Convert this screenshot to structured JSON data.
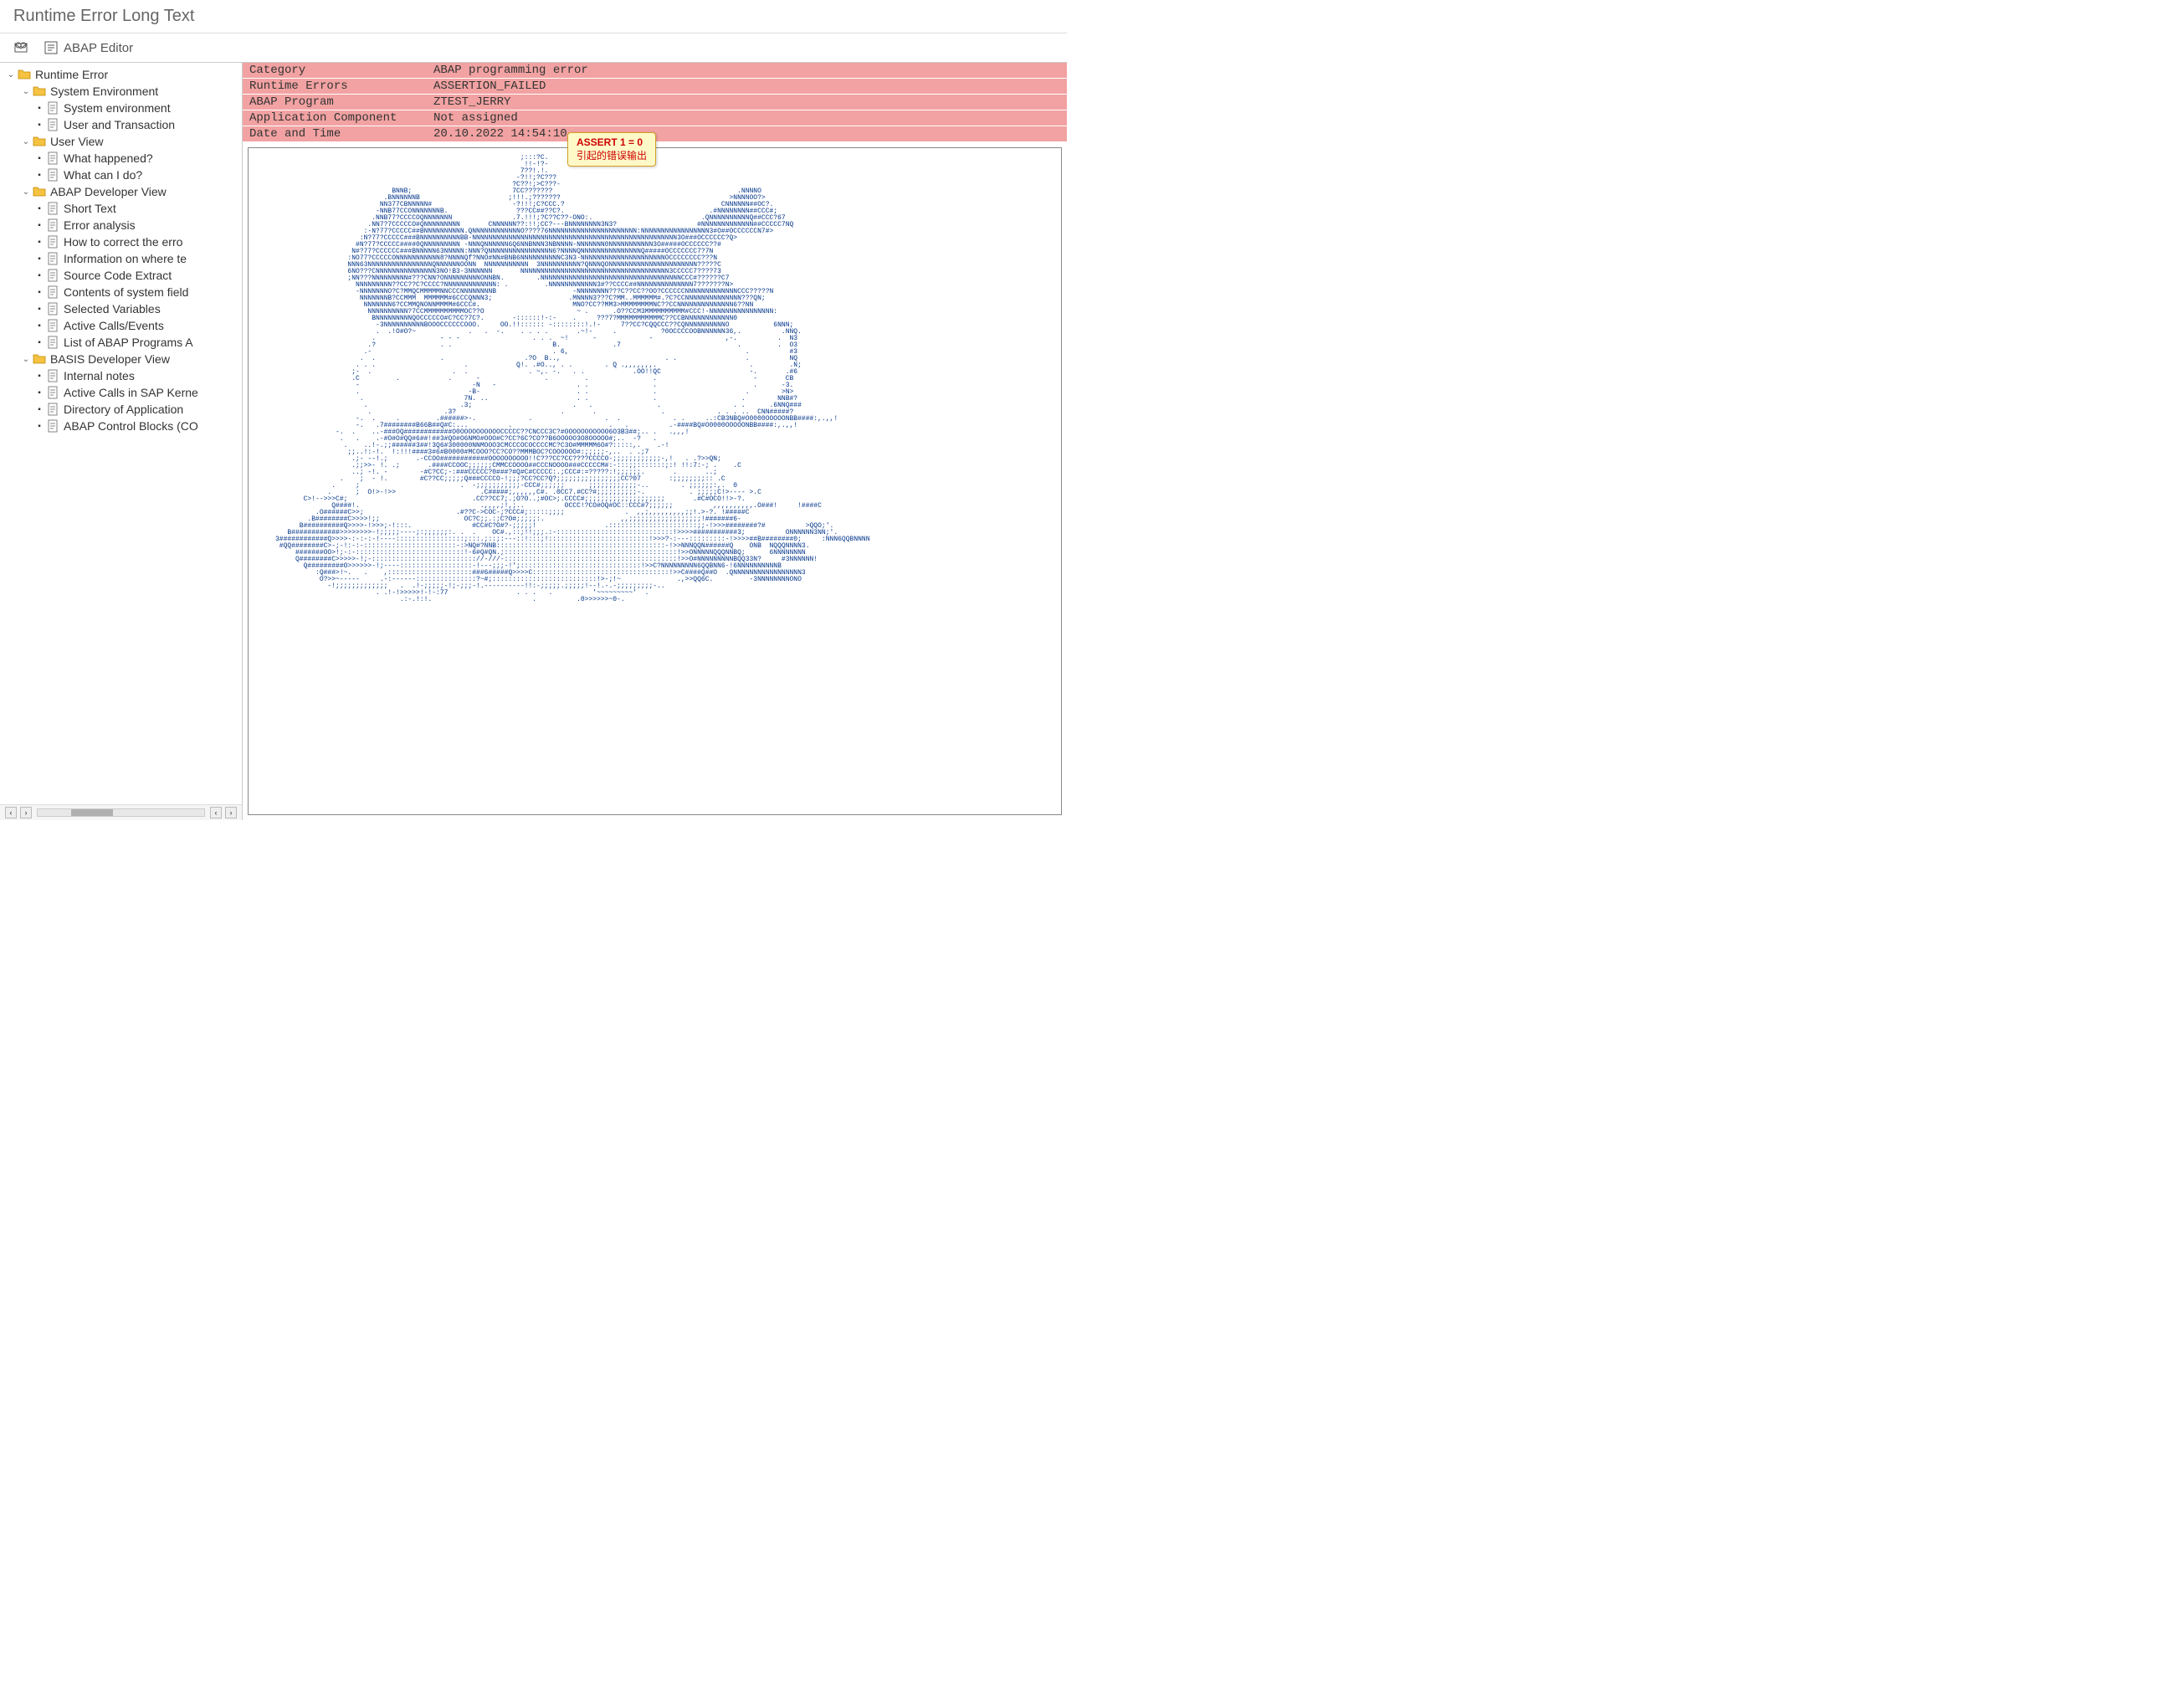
{
  "title": "Runtime Error Long Text",
  "toolbar": {
    "editor_label": "ABAP Editor"
  },
  "tree": [
    {
      "label": "Runtime Error",
      "type": "folder",
      "indent": 0,
      "expanded": true
    },
    {
      "label": "System Environment",
      "type": "folder",
      "indent": 1,
      "expanded": true
    },
    {
      "label": "System environment",
      "type": "doc",
      "indent": 2
    },
    {
      "label": "User and Transaction",
      "type": "doc",
      "indent": 2
    },
    {
      "label": "User View",
      "type": "folder",
      "indent": 1,
      "expanded": true
    },
    {
      "label": "What happened?",
      "type": "doc",
      "indent": 2
    },
    {
      "label": "What can I do?",
      "type": "doc",
      "indent": 2
    },
    {
      "label": "ABAP Developer View",
      "type": "folder",
      "indent": 1,
      "expanded": true
    },
    {
      "label": "Short Text",
      "type": "doc",
      "indent": 2
    },
    {
      "label": "Error analysis",
      "type": "doc",
      "indent": 2
    },
    {
      "label": "How to correct the erro",
      "type": "doc",
      "indent": 2
    },
    {
      "label": "Information on where te",
      "type": "doc",
      "indent": 2
    },
    {
      "label": "Source Code Extract",
      "type": "doc",
      "indent": 2
    },
    {
      "label": "Contents of system field",
      "type": "doc",
      "indent": 2
    },
    {
      "label": "Selected Variables",
      "type": "doc",
      "indent": 2
    },
    {
      "label": "Active Calls/Events",
      "type": "doc",
      "indent": 2
    },
    {
      "label": "List of ABAP Programs A",
      "type": "doc",
      "indent": 2
    },
    {
      "label": "BASIS Developer View",
      "type": "folder",
      "indent": 1,
      "expanded": true
    },
    {
      "label": "Internal notes",
      "type": "doc",
      "indent": 2
    },
    {
      "label": "Active Calls in SAP Kerne",
      "type": "doc",
      "indent": 2
    },
    {
      "label": "Directory of Application",
      "type": "doc",
      "indent": 2
    },
    {
      "label": "ABAP Control Blocks (CO",
      "type": "doc",
      "indent": 2
    }
  ],
  "header": {
    "rows": [
      {
        "key": "Category",
        "value": "ABAP programming error"
      },
      {
        "key": "Runtime Errors",
        "value": "ASSERTION_FAILED"
      },
      {
        "key": "ABAP Program",
        "value": "ZTEST_JERRY"
      },
      {
        "key": "Application Component",
        "value": "Not assigned"
      },
      {
        "key": "Date and Time",
        "value": "20.10.2022 14:54:10"
      }
    ]
  },
  "callout": {
    "line1": "ASSERT 1 = 0",
    "line2": "引起的错误输出"
  },
  "ascii": "                                                                  ;:::?C.\n                                                                   !!-!?-\n                                                                  7??!.!.\n                                                                 -?!!;?C???\n                                                                ?C??!;>C???-\n                                  BNNB;                         7CC???????                                              .NNNNO\n                                .BNNNNNNB                      ;!!!.;???????                                          >NNNNOO?>\n                               NN377CBNNNNN#                    -?!!!;C?CCC.?                                       CNNNNNN##OC?.\n                              -NNB77CCONNNNNNNB.                 ???CC##??C?.                                    .#NNNNNNNN##CCC#;\n                             .NNB77?CCCCOQNNNNNNN               .7.!!!;?C??C??-ONO:.                           .QNNNNNNNNNNQ##CCC?67\n                            .NN7?7CCCCCO#QNNNNNNNNN       CNNNNNN??:!!;CC?---BNNNNNNNN3N3?                    #NNNNNNNNNNNNN##CCCCC7NQ\n                           :-N?77?CCCCC##BNNNNNNNNNN.QNNNNNNNNNNNNO????76NNNNNNNNNNNNNNNNNNNNNN:NNNNNNNNNNNNNNNNN3#O##OCCCCCCN7#>\n                          :N?77?CCCCC###BNNNNNNNNNNBB-NNNNNNNNNNNNNNNNNNNNNNNNNNNNNNNNNNNNNNNNNNNNNNNNNNN3O###OCCCCCC?Q>\n                         #N?77?CCCCC####0QNNNNNNNNN -NNNQNNNNNN6Q6NNBNNN3NBNNNN-NNNNNNN0NNNNNNNNNNN3O#####OCCCCCC??#\n                        N#?77?CCCCCC###BNNNNN63NNNNN:NNN?QNNNNNNNNNNNNNNNN6?NNNNQNNNNNNNNNNNNNNNQ#####OCCCCCCC7?7N\n                       :NO77?CCCCCONNNNNNNNNNN8?NNNNQf?NNO#NN#BNB6NNNNNNNNNNC3N3-NNNNNNNNNNNNNNNNNNNNNOCCCCCCCC???N\n                       NNN63NNNNNNNNNNNNNNNNQNNNNNNOONN  NNNNNNNNNNN  3NNNNNNNNNN?QNNNQONNNNNNNNNNNNNNNNNNNNNN?????C\n                       6NO???CNNNNNNNNNNNNNNN3NO!B3-3NNNNNN       NNNNNNNNNNNNNNNNNNNNNNNNNNNNNNNNNNNNN3CCCCC7????73\n                       ;NN???NNNNNNNNN#???CNN?ONNNNNNNNNONNBN.        .NNNNNNNNNNNNNNNNNNNNNNNNNNNNNNNNNNNCCC#??????C7\n                         NNNNNNNNN??CC??C?CCCC?NNNNNNNNNNNNN: .         .NNNNNNNNNNNN3#??CCCC##NNNNNNNNNNNNNN7???????N>\n                         -NNNNNNNO?C?MMQCMMMMMNNCCCNNNNNNNNB                   -NNNNNNNN???C??CC??OO?CCCCCCNNNNNNNNNNNNNCCC?????N\n                          NNNNNNNB?CCMMM  MMMMMM#6CCCQNNN3;                   .MNNNN3???C?MM..MMMMMM#.?C?CCNNNNNNNNNNNNNN???QN;\n                           NNNNNNN6?CCMMQNONNMMMM#6CCC#.                       MNO?CC??MM3>MMMMMMMMNC??CCNNNNNNNNNNNNNN6??NN\n                            NNNNNNNNNN?7CCMMMMMMMMMMOC??O                       ~ .      .O??CCM3MMMMMMMMMM#CCC!-NNNNNNNNNNNNNNNN:\n                             BNNNNNNNNNQOCCCCCO#C?CC?7C?.       -::::::!-:-    .     ???7?MMMMMMMMMMMC??CCBNNNNNNNNNNNN0\n                              -3NNNNNNNNNNBOOOCCCCCCOOO.     OO.!!:::::: -::::::::!.!-     7??CC?CQQCCC??CQNNNNNNNNNNO           6NNN;\n                              .  .!O#O?~             .   .  -.    . . . .       .~!-     .           ?0OCCCCOOBNNNNNN36,.          .NNQ.\n                             .                - - -                  . . .  ~!      -             -                  ,-.          .  N3\n                            .?                . .                         B.             .7                             .         .  O3\n                           .-                                             . 6,                                            .          #3\n                          .  .                .                    .?O  B..,                          . .                 .          NQ\n                         . . .                      .            Q!. .#O.., . .        . Q .,,,,,,,.                       .         .N;\n                        ;-  .                    .  .               . ~,. -.   . .            .OO!!QC                      -.       .#6\n                        .C         .            .      -                .         .                .                        -       CB\n                         -                            -N   -                    . .                .                        .      -3.\n                         .                           -B-                        . .                .                      .        >N>\n                          .                         7N. ..                      . .                .                     .        NNB#?\n                           .                       .3;                         .   .                .                  . .      .6NNQ###\n                            .                  .3?                          .       .                .             . . . ..  CNN#####?\n                         -.  .     .         .######>-.             .                  .  .             . .     ..:CB3NBQ#O0000OOOOONBB####:,.,,!\n                         -.   .7########B66B##Q#C:...          .                        .   .          .-####BQ#O0000OOOOONBB####:,.,,!\n                    -.  .    ..-###OQ############O0OOOOOOOOOOCCCCC??CNCCC3C?#OOOOOOOOOOO6O3B3##;.. .   .,,,!\n                     .   .    .-#O#O#QQ#6##!##3#QO#O6NMO#OOO#C?CC?6C?CO??B6OOOOO3O8OOOOO#;..  -?   .\n                      .    ..!-.;;######3##!3Q6#300000NNMOOO3CMCCCOCOCCCCMC?C3O#MMMMM6O#?:::::,.    .-!\n                       ;;..!:-!.  !:!!!####3#6#B0000#MCOOO?CC?CO??MMMBOC?COOOOOO#:;;;;;-,..  . .;7\n                        .;- --!.;       .-CCOO############OOOOOOOOOO!!C???CC?CC????CCCCO-;;;;;;;;;;;;-,!   . .?>>QN;\n                        .;;>>- !. .;       .####CCOOC;;;;;;CMMCCOOOO##CCCNOOOO###CCCCCM#:-:::;;:::::::;:! !!:7:-; .    .C\n                        ..; -!. -        -#C?CC;-:###CCCCC?0###?#Q#C#CCCCC:.;CCC#:=?????:!;;;;;;.       .       ..;\n                     .    ;  - !.        #C??CC;;;;;Q###CCCCO-!;;;?CC?CC?Q?;;;;;;;;;;;;;;;;CC?07       :;;;;;;;;:: .C\n                   .     ;                         .  -;;;;;;;;;;;-CCC#;;;;;;      ;;;;;;;;;;;;-..        . ;;;;;;:,.  0\n                  .      ;  O!>-!>>                     .C#####;,,,,,,C#. .0CC7.#CC?#;;;;;;;;;;-.           . ;;;;;C!>---- >.C\n            C>!-->>>C#;                               .CC??CC7;.;O?O..;#OC>;.CCCC#;;;;;;;;;;;;;;;;;;;;       .#C#OCO!!>-?.\n                   Q####!.                              .,,,,;!,;..          OCCC!?CO#OQ#OC::CCC#7;;;;;;          ,,,,,,,,,,.O###!     !####C\n               .O######C>>;                       .#??C->COC-;?CCC#;:::::;;;;               .  ,,;,,,,,,,,,;;!.>-?. !#####C\n             .B########C>>>>!;;                     OC?C;;.:;C?O#;;;;;:.                   ,,;;;;;;;;;;;;;;;;;;!#######6-\n           B##########Q>>>>-!>>>;-!:::.               #CC#C?O#?-;;;;;!                 .::::::::::::::::::::::;;-!>>>########?#          >QQO;'.\n        B############>>>>>>>>-!;;;;;----;:;;;;;;:. .  .    OC#.,::;!!;;;.:-:::::::::::::::::::::::::::::!>>>>###########3;          ONNNNNN3NN;'.\n     3############Q>>>>-:-:-:-!----:::::::::::::::::;:::.;::;:---::!:::;!:::::::::::::::::::::::::!>>>?-:---:::::::::-!>>>>##B########0;     :NNN6QQBNNNN\n      #QQ########C>-;-!:-:-:::::::::::::::::::::::-:>NQ#?NNB::::::::::::::::::::::::::::::::::::::::::-!>>NNNQQN######Q    ONB  NQQQNNNN3.\n          #######OO>!;-:-:::::::::::::::::::::::::::!-6#Q#QN.;:::::::::::::::::::::::::::::::::::::::::::!>>ONNNNNQQQNNBQ;      6NNNNNNNN\n          Q########C>>>>>-!;-:::::::::::::::::::::::::://-///-:::::::::::::::::::::::::::::::::::::::::::!>>O#NNNNNNNNNBQQ33N?     #3NNNNNN!\n            Q#########O>>>>>>-!;----::::::::::::::::::-!---;;;-!';::::::::::::::::::::::::::::::!>>C?NNNNNNNNN6QQBNN6-!6NNNNNNNNNNB\n               :Q###>!~.   .    ,:::::::::::::::::::::###6#####Q>>>>C::::::::::::::::::::::::::::::::::!>>C####Q##O  .QNNNNNNNNNNNNNNNNN3\n                O?>>~-----     .-:------:::::::::::::::?~#;::::::::::::::::::::::::::!>-;!~              .,>>QQ6C.         -3NNNNNNNNONO\n                  -!;;;;;;;;;;;;;   .  .!-;;;;;-!;-;;;-!.----------!!:-;;;;;.;;;;;!--!.-.-;;;;;;;;;-..\n                              . .!-!>>>>>!-!-:77                 . . .   .          '~~~~~~~~~'  .\n                                    .:-.!:!.                         .          .0>>>>>>~0-."
}
